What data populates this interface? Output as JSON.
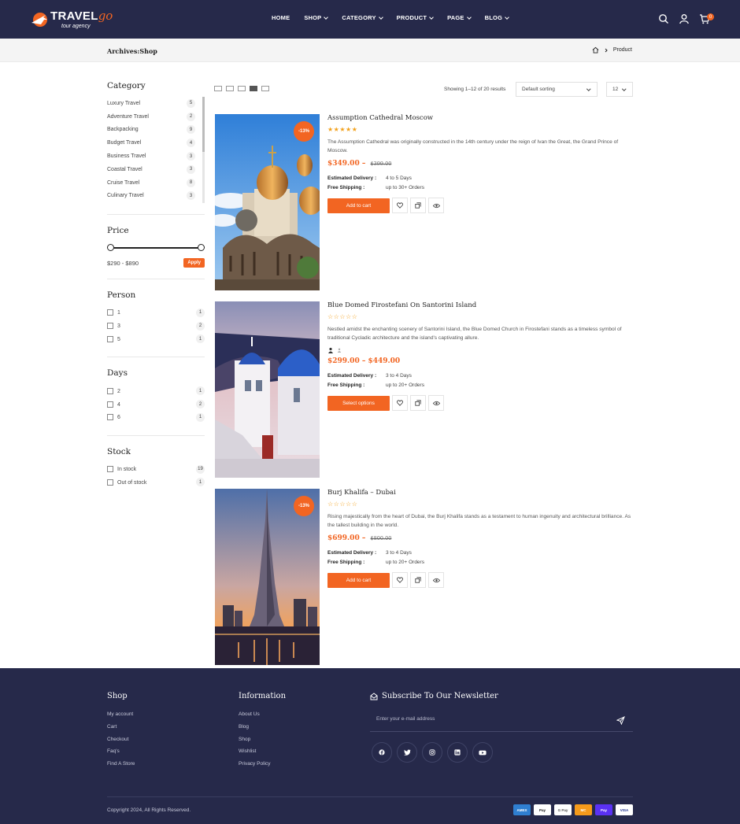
{
  "colors": {
    "header_bg": "#26294a",
    "accent": "#f26522",
    "star": "#f2a01a"
  },
  "header": {
    "logo_main": "TRAVEL",
    "logo_go": "go",
    "logo_sub": "tour agency",
    "nav": [
      "HOME",
      "SHOP",
      "CATEGORY",
      "PRODUCT",
      "PAGE",
      "BLOG"
    ],
    "cart_count": "0"
  },
  "breadcrumb": {
    "title": "Archives:Shop",
    "current": "Product"
  },
  "sidebar": {
    "category_title": "Category",
    "categories": [
      {
        "label": "Luxury Travel",
        "count": "5"
      },
      {
        "label": "Adventure Travel",
        "count": "2"
      },
      {
        "label": "Backpacking",
        "count": "9"
      },
      {
        "label": "Budget Travel",
        "count": "4"
      },
      {
        "label": "Business Travel",
        "count": "3"
      },
      {
        "label": "Coastal Travel",
        "count": "3"
      },
      {
        "label": "Cruise Travel",
        "count": "8"
      },
      {
        "label": "Culinary Travel",
        "count": "3"
      }
    ],
    "price_title": "Price",
    "price_range": "$290 - $890",
    "apply_label": "Apply",
    "person_title": "Person",
    "person": [
      {
        "label": "1",
        "count": "1"
      },
      {
        "label": "3",
        "count": "2"
      },
      {
        "label": "5",
        "count": "1"
      }
    ],
    "days_title": "Days",
    "days": [
      {
        "label": "2",
        "count": "1"
      },
      {
        "label": "4",
        "count": "2"
      },
      {
        "label": "6",
        "count": "1"
      }
    ],
    "stock_title": "Stock",
    "stock": [
      {
        "label": "In stock",
        "count": "19"
      },
      {
        "label": "Out of stock",
        "count": "1"
      }
    ]
  },
  "toolbar": {
    "showing": "Showing 1–12 of 20 results",
    "sort": "Default sorting",
    "per_page": "12"
  },
  "products": [
    {
      "title": "Assumption Cathedral Moscow",
      "badge": "-13%",
      "stars": "★★★★★",
      "desc": "The Assumption Cathedral was originally constructed in the 14th century under the reign of Ivan the Great, the Grand Prince of Moscow.",
      "price": "$349.00",
      "old_price": "$399.00",
      "delivery_label": "Estimated Delivery :",
      "delivery": "4 to 5 Days",
      "shipping_label": "Free Shipping :",
      "shipping": "up to 30+ Orders",
      "button": "Add to cart"
    },
    {
      "title": "Blue Domed Firostefani On Santorini Island",
      "stars": "☆☆☆☆☆",
      "desc": "Nestled amidst the enchanting scenery of Santorini Island, the Blue Domed Church in Firostefani stands as a timeless symbol of traditional Cycladic architecture and the island's captivating allure.",
      "price": "$299.00 – $449.00",
      "delivery_label": "Estimated Delivery :",
      "delivery": "3 to 4 Days",
      "shipping_label": "Free Shipping :",
      "shipping": "up to 20+ Orders",
      "button": "Select options"
    },
    {
      "title": "Burj Khalifa – Dubai",
      "badge": "-13%",
      "stars": "☆☆☆☆☆",
      "desc": "Rising majestically from the heart of Dubai, the Burj Khalifa stands as a testament to human ingenuity and architectural brilliance. As the tallest building in the world.",
      "price": "$699.00",
      "old_price": "$800.00",
      "delivery_label": "Estimated Delivery :",
      "delivery": "3 to 4 Days",
      "shipping_label": "Free Shipping :",
      "shipping": "up to 20+ Orders",
      "button": "Add to cart"
    }
  ],
  "footer": {
    "shop_title": "Shop",
    "shop_links": [
      "My account",
      "Cart",
      "Checkout",
      "Faq's",
      "Find A Store"
    ],
    "info_title": "Information",
    "info_links": [
      "About Us",
      "Blog",
      "Shop",
      "Wishlist",
      "Privacy Policy"
    ],
    "newsletter_title": "Subscribe To Our Newsletter",
    "email_placeholder": "Enter your e-mail address",
    "copyright": "Copyright 2024, All Rights Reserved.",
    "payments": [
      "AMEX",
      "Pay",
      "G Pay",
      "MC",
      "Pay",
      "VISA"
    ]
  }
}
